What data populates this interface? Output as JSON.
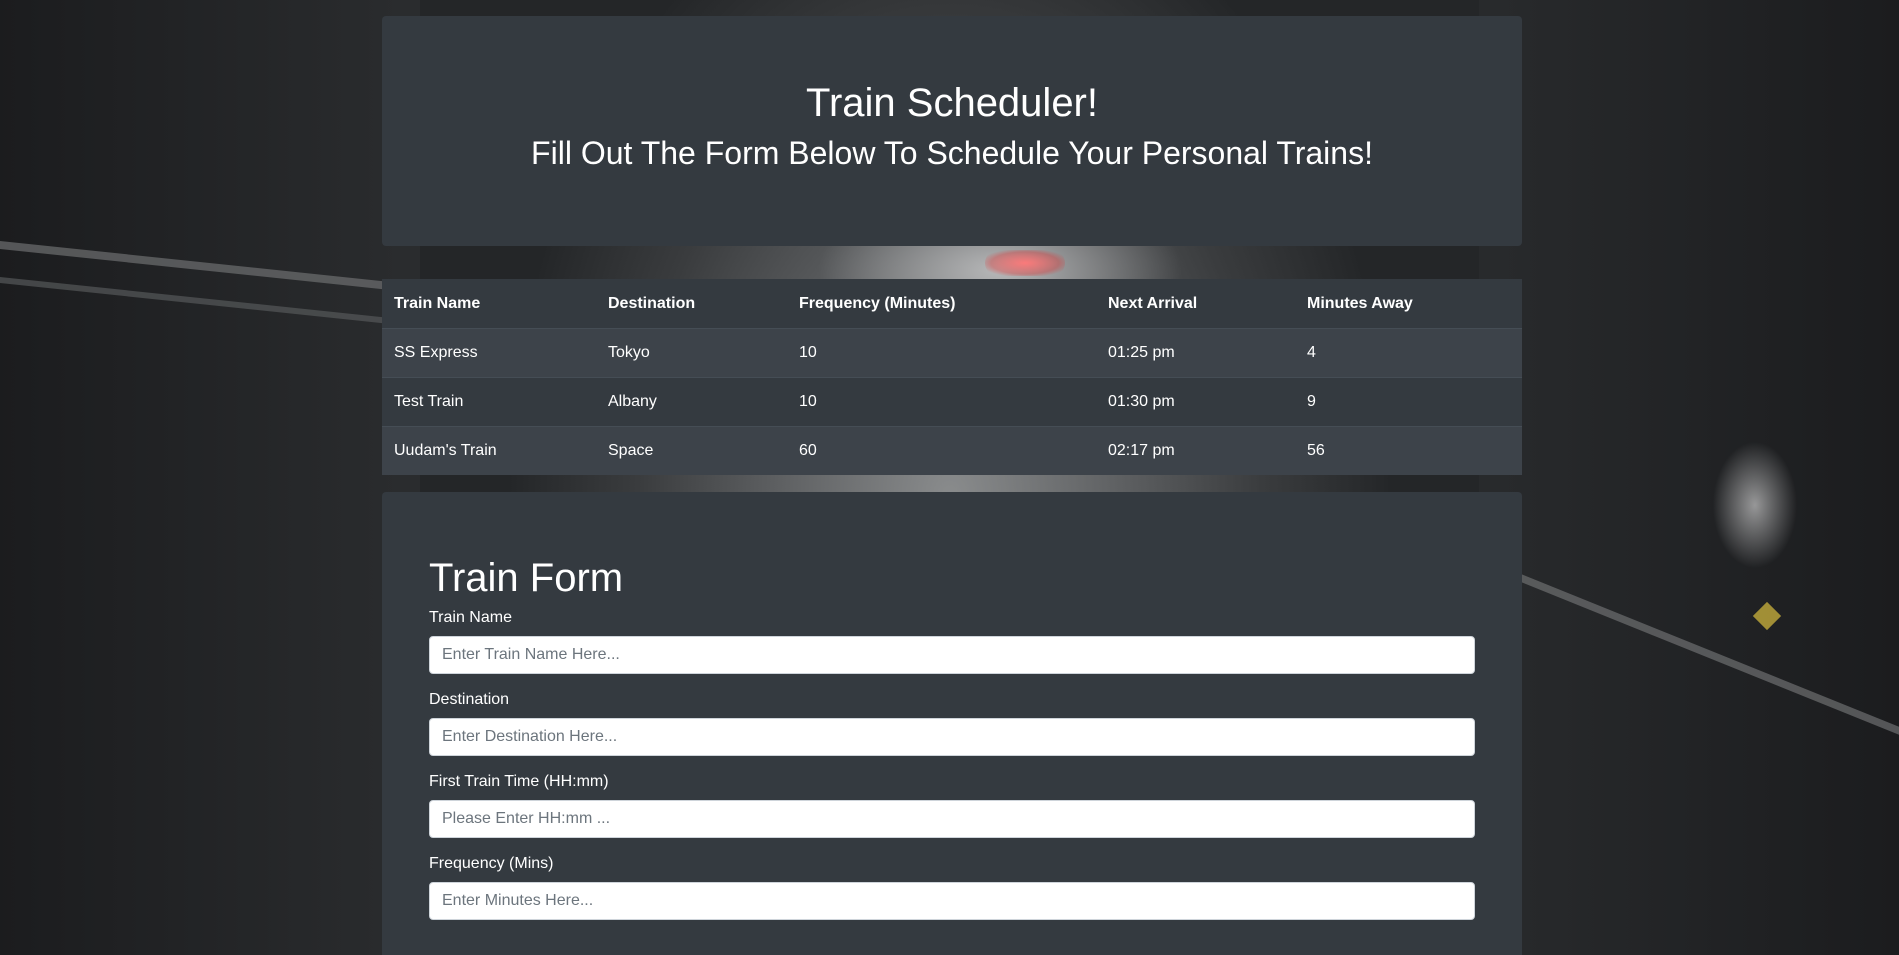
{
  "header": {
    "title": "Train Scheduler!",
    "subtitle": "Fill Out The Form Below To Schedule Your Personal Trains!"
  },
  "table": {
    "columns": [
      "Train Name",
      "Destination",
      "Frequency (Minutes)",
      "Next Arrival",
      "Minutes Away"
    ],
    "rows": [
      [
        "SS Express",
        "Tokyo",
        "10",
        "01:25 pm",
        "4"
      ],
      [
        "Test Train",
        "Albany",
        "10",
        "01:30 pm",
        "9"
      ],
      [
        "Uudam's Train",
        "Space",
        "60",
        "02:17 pm",
        "56"
      ]
    ]
  },
  "form": {
    "title": "Train Form",
    "fields": [
      {
        "label": "Train Name",
        "placeholder": "Enter Train Name Here...",
        "value": ""
      },
      {
        "label": "Destination",
        "placeholder": "Enter Destination Here...",
        "value": ""
      },
      {
        "label": "First Train Time (HH:mm)",
        "placeholder": "Please Enter HH:mm ...",
        "value": ""
      },
      {
        "label": "Frequency (Mins)",
        "placeholder": "Enter Minutes Here...",
        "value": ""
      }
    ]
  },
  "colors": {
    "panel": "#343a40",
    "row_striped": "#3d434a",
    "border": "#454d55",
    "text": "#ffffff"
  }
}
